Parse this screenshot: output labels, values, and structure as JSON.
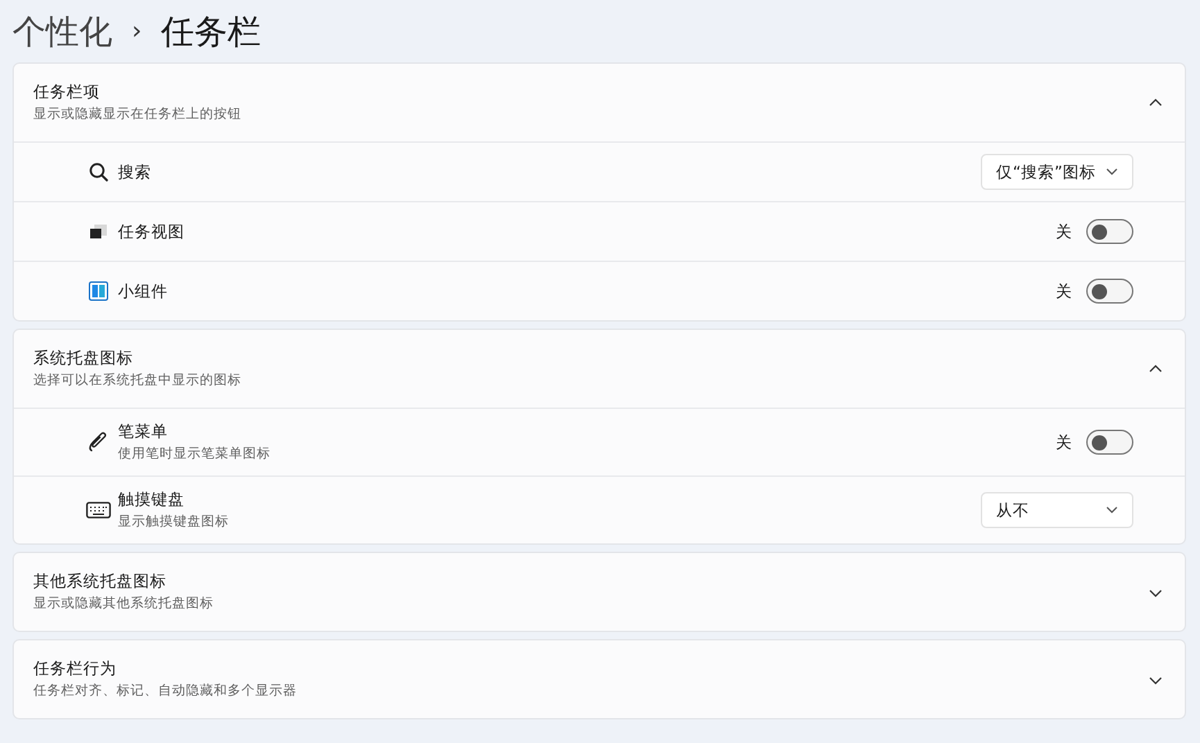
{
  "breadcrumb": {
    "parent": "个性化",
    "separator": "›",
    "current": "任务栏"
  },
  "sections": [
    {
      "title": "任务栏项",
      "subtitle": "显示或隐藏显示在任务栏上的按钮",
      "expanded": true,
      "items": [
        {
          "label": "搜索",
          "control": {
            "kind": "dropdown",
            "value": "仅“搜索”图标"
          }
        },
        {
          "label": "任务视图",
          "control": {
            "kind": "toggle",
            "state_label": "关",
            "on": false
          }
        },
        {
          "label": "小组件",
          "control": {
            "kind": "toggle",
            "state_label": "关",
            "on": false
          }
        }
      ]
    },
    {
      "title": "系统托盘图标",
      "subtitle": "选择可以在系统托盘中显示的图标",
      "expanded": true,
      "items": [
        {
          "label": "笔菜单",
          "description": "使用笔时显示笔菜单图标",
          "control": {
            "kind": "toggle",
            "state_label": "关",
            "on": false
          }
        },
        {
          "label": "触摸键盘",
          "description": "显示触摸键盘图标",
          "control": {
            "kind": "dropdown",
            "value": "从不"
          }
        }
      ]
    },
    {
      "title": "其他系统托盘图标",
      "subtitle": "显示或隐藏其他系统托盘图标",
      "expanded": false
    },
    {
      "title": "任务栏行为",
      "subtitle": "任务栏对齐、标记、自动隐藏和多个显示器",
      "expanded": false
    }
  ]
}
